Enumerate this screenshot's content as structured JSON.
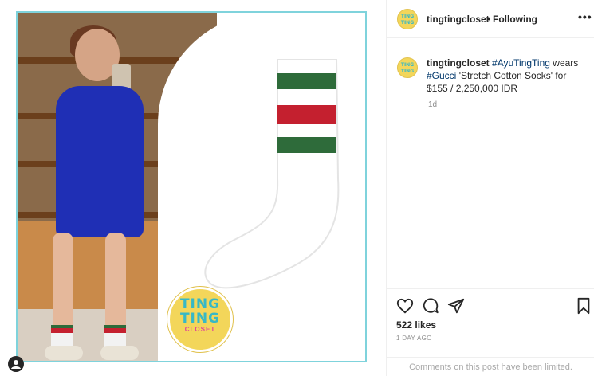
{
  "header": {
    "username": "tingtingcloset",
    "separator": "•",
    "follow_status": "Following",
    "more_icon": "more-options-icon"
  },
  "brand_logo": {
    "line1": "TING",
    "line2": "TING",
    "line3": "CLOSET"
  },
  "caption": {
    "username": "tingtingcloset",
    "tag1": "#AyuTingTing",
    "text1": " wears ",
    "tag2": "#Gucci",
    "text2": " 'Stretch Cotton Socks' for $155 / 2,250,000 IDR",
    "time": "1d"
  },
  "actions": {
    "like_icon": "heart-icon",
    "comment_icon": "comment-icon",
    "share_icon": "share-icon",
    "save_icon": "bookmark-icon"
  },
  "likes": "522 likes",
  "date": "1 DAY AGO",
  "comments_limited": "Comments on this post have been limited.",
  "colors": {
    "frame": "#7fd3dc",
    "sock_green": "#2e6b3a",
    "sock_red": "#c4202f",
    "logo_yellow": "#f3d65a",
    "logo_text": "#37b8c6",
    "hashtag": "#00376b"
  }
}
